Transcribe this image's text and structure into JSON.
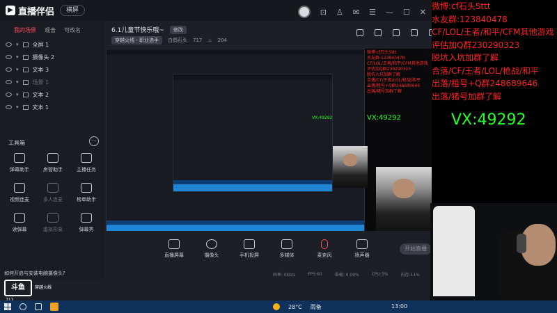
{
  "app": {
    "brand": "直播伴侣",
    "mode": "横屏",
    "left_tabs": [
      "我的场景",
      "观击",
      "可改名"
    ],
    "scenes": [
      {
        "label": "全屏 1",
        "dim": false
      },
      {
        "label": "摄像头 2",
        "dim": false
      },
      {
        "label": "文本 3",
        "dim": false
      },
      {
        "label": "场景 1",
        "dim": true
      },
      {
        "label": "文本 2",
        "dim": false
      },
      {
        "label": "文本 1",
        "dim": false
      }
    ],
    "toolbox_title": "工具箱",
    "tools": [
      {
        "label": "弹幕助手",
        "dim": false
      },
      {
        "label": "房管助手",
        "dim": false
      },
      {
        "label": "主播任务",
        "dim": false
      },
      {
        "label": "视频连麦",
        "dim": false
      },
      {
        "label": "多人连麦",
        "dim": true
      },
      {
        "label": "榜单助手",
        "dim": false
      },
      {
        "label": "读弹幕",
        "dim": false
      },
      {
        "label": "虚拟形象",
        "dim": true
      },
      {
        "label": "弹幕秀",
        "dim": false
      }
    ],
    "preview_title": "6.1儿童节快乐哦~",
    "edit_label": "修改",
    "info_tag": "穿越火线 - 职业选手",
    "info_name": "白鸽石头",
    "info_count_a": "717",
    "info_count_b": "204",
    "controls": [
      "直播屏幕",
      "摄像头",
      "手机投屏",
      "多媒体",
      "麦克风",
      "扬声器"
    ],
    "start_label": "开始直播",
    "status_items": [
      "码率: 0kb/s",
      "FPS:60",
      "丢帧: 0.00%",
      "CPU:3%",
      "内存:11%"
    ],
    "notice": "如何开启与安装电脑摄像头?",
    "watermark": {
      "logo": "斗鱼",
      "room_id": "717",
      "text": "穿越火线"
    }
  },
  "overlay": {
    "lines": [
      "微博:cf石头Sttt",
      "水友群:123840478",
      "CF/LOL/王者/和平/CFM其他游戏",
      "评估加Q群230290323",
      "脱坑入坑加群了解",
      "合落/CF/王者/LOL/枪战/和平",
      "出落/租号+Q群248689646",
      "出落/猪号加群了解"
    ],
    "vx": "VX:49292",
    "red_color": "#ff2222",
    "green_color": "#22ff22"
  },
  "taskbar": {
    "temperature": "28°C",
    "weather": "雨备",
    "clock": "13:00"
  }
}
